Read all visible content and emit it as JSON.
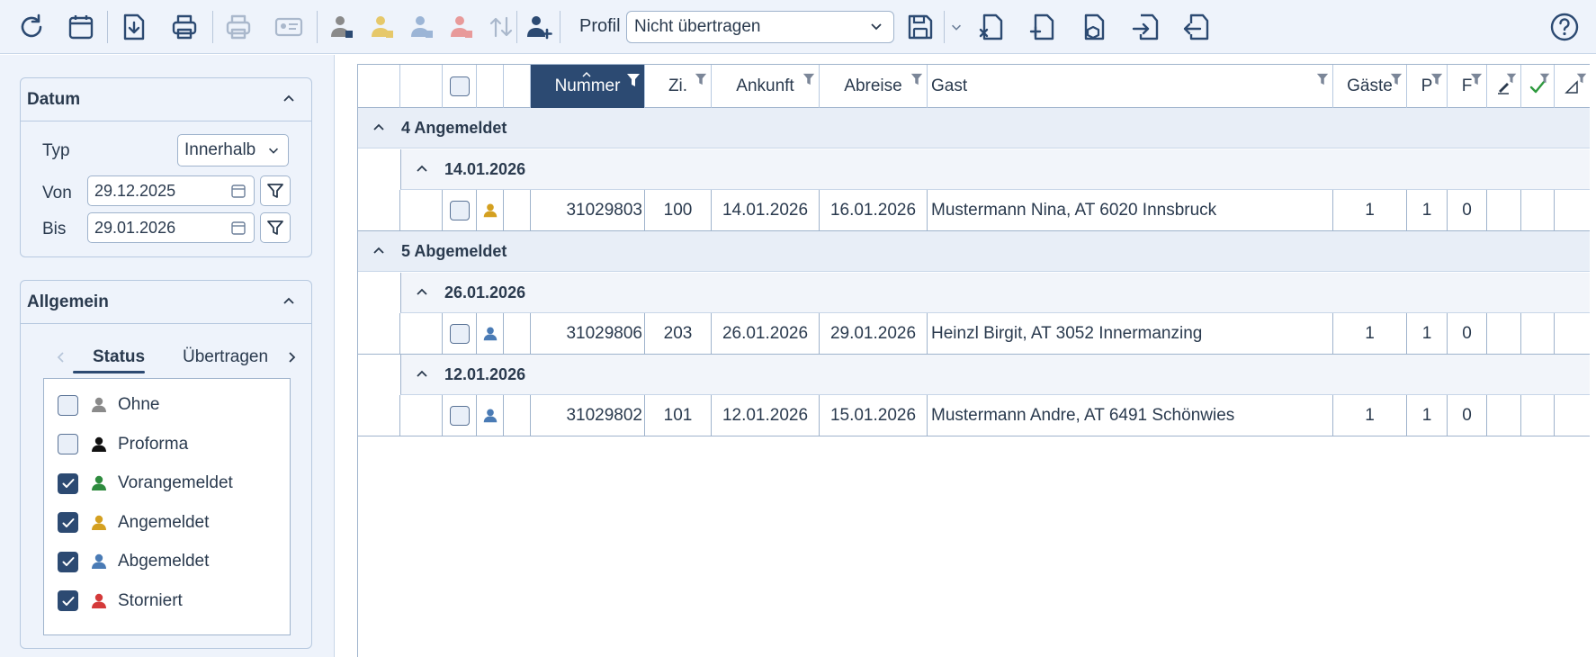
{
  "toolbar": {
    "profil_label": "Profil",
    "profil_value": "Nicht übertragen",
    "icons": [
      "refresh-icon",
      "calendar-icon",
      "download-icon",
      "print-icon",
      "print-disabled-icon",
      "id-card-icon",
      "person-grey-icon",
      "person-yellow-icon",
      "person-blue-icon",
      "person-red-icon",
      "sort-arrows-icon",
      "add-person-icon",
      "save-icon",
      "export-x-icon",
      "export-plus-icon",
      "export-box-icon",
      "import-icon",
      "export-arrow-icon",
      "help-icon"
    ]
  },
  "colors": {
    "accent": "#2c4a72",
    "ohne": "#8a8a8a",
    "proforma": "#111111",
    "vorangemeldet": "#2e8b3e",
    "angemeldet": "#d4a020",
    "abgemeldet": "#4a7bb5",
    "storniert": "#d43a3a"
  },
  "datum": {
    "title": "Datum",
    "typ_label": "Typ",
    "typ_value": "Innerhalb",
    "von_label": "Von",
    "von_value": "29.12.2025",
    "bis_label": "Bis",
    "bis_value": "29.01.2026"
  },
  "allgemein": {
    "title": "Allgemein",
    "tabs": [
      {
        "label": "Status"
      },
      {
        "label": "Übertragen"
      }
    ],
    "status_items": [
      {
        "label": "Ohne",
        "checked": false,
        "color": "#8a8a8a"
      },
      {
        "label": "Proforma",
        "checked": false,
        "color": "#111111"
      },
      {
        "label": "Vorangemeldet",
        "checked": true,
        "color": "#2e8b3e"
      },
      {
        "label": "Angemeldet",
        "checked": true,
        "color": "#d4a020"
      },
      {
        "label": "Abgemeldet",
        "checked": true,
        "color": "#4a7bb5"
      },
      {
        "label": "Storniert",
        "checked": true,
        "color": "#d43a3a"
      }
    ]
  },
  "grid": {
    "columns": {
      "nummer": "Nummer",
      "zi": "Zi.",
      "ankunft": "Ankunft",
      "abreise": "Abreise",
      "gast": "Gast",
      "gaeste": "Gäste",
      "p": "P",
      "f": "F"
    },
    "groups": [
      {
        "label": "4 Angemeldet",
        "dates": [
          {
            "label": "14.01.2026",
            "rows": [
              {
                "nummer": "31029803",
                "zi": "100",
                "ankunft": "14.01.2026",
                "abreise": "16.01.2026",
                "gast": "Mustermann Nina, AT 6020 Innsbruck",
                "gaeste": "1",
                "p": "1",
                "f": "0",
                "status_color": "#d4a020"
              }
            ]
          }
        ]
      },
      {
        "label": "5 Abgemeldet",
        "dates": [
          {
            "label": "26.01.2026",
            "rows": [
              {
                "nummer": "31029806",
                "zi": "203",
                "ankunft": "26.01.2026",
                "abreise": "29.01.2026",
                "gast": "Heinzl Birgit, AT 3052 Innermanzing",
                "gaeste": "1",
                "p": "1",
                "f": "0",
                "status_color": "#4a7bb5"
              }
            ]
          },
          {
            "label": "12.01.2026",
            "rows": [
              {
                "nummer": "31029802",
                "zi": "101",
                "ankunft": "12.01.2026",
                "abreise": "15.01.2026",
                "gast": "Mustermann Andre, AT 6491 Schönwies",
                "gaeste": "1",
                "p": "1",
                "f": "0",
                "status_color": "#4a7bb5"
              }
            ]
          }
        ]
      }
    ]
  }
}
